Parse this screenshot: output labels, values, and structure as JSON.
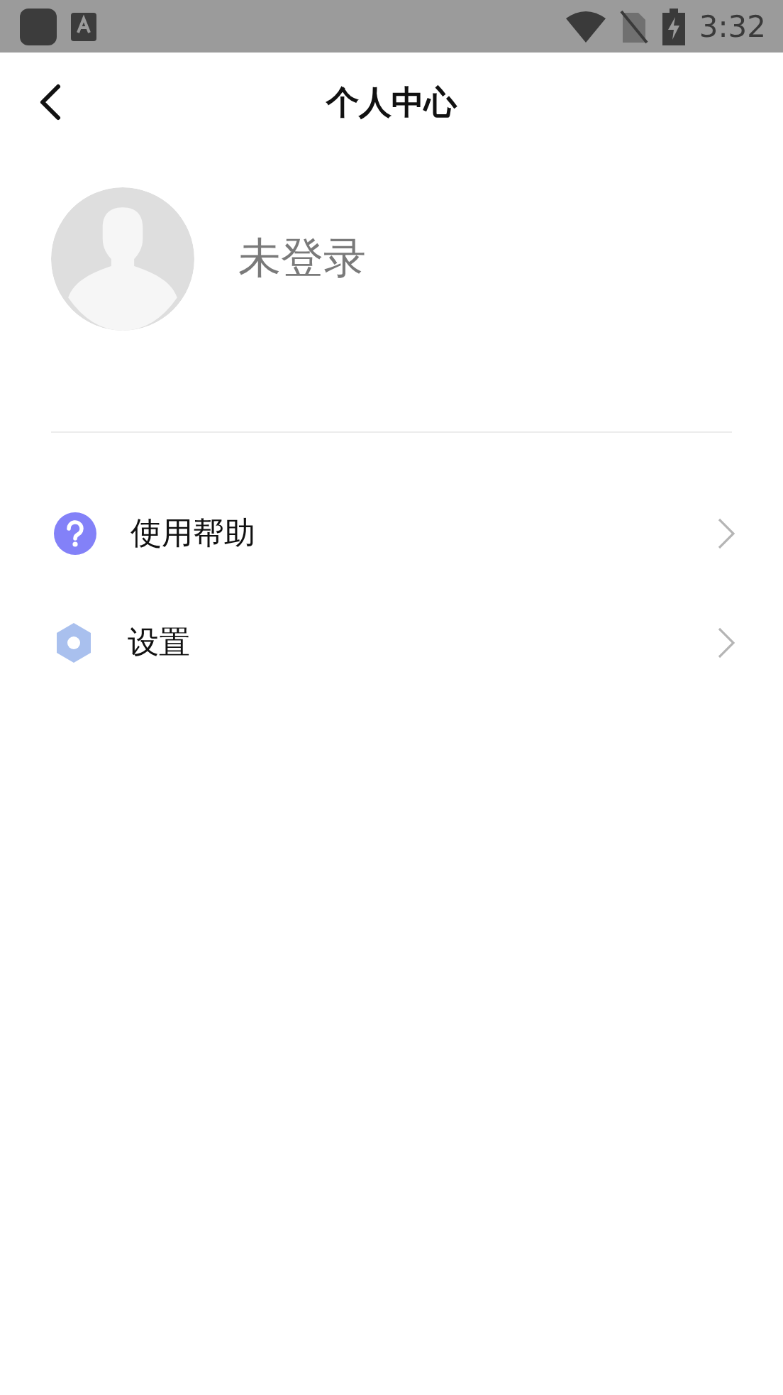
{
  "status_bar": {
    "time": "3:32"
  },
  "header": {
    "title": "个人中心"
  },
  "profile": {
    "name": "未登录"
  },
  "menu": [
    {
      "kind": "help",
      "label": "使用帮助"
    },
    {
      "kind": "settings",
      "label": "设置"
    }
  ]
}
